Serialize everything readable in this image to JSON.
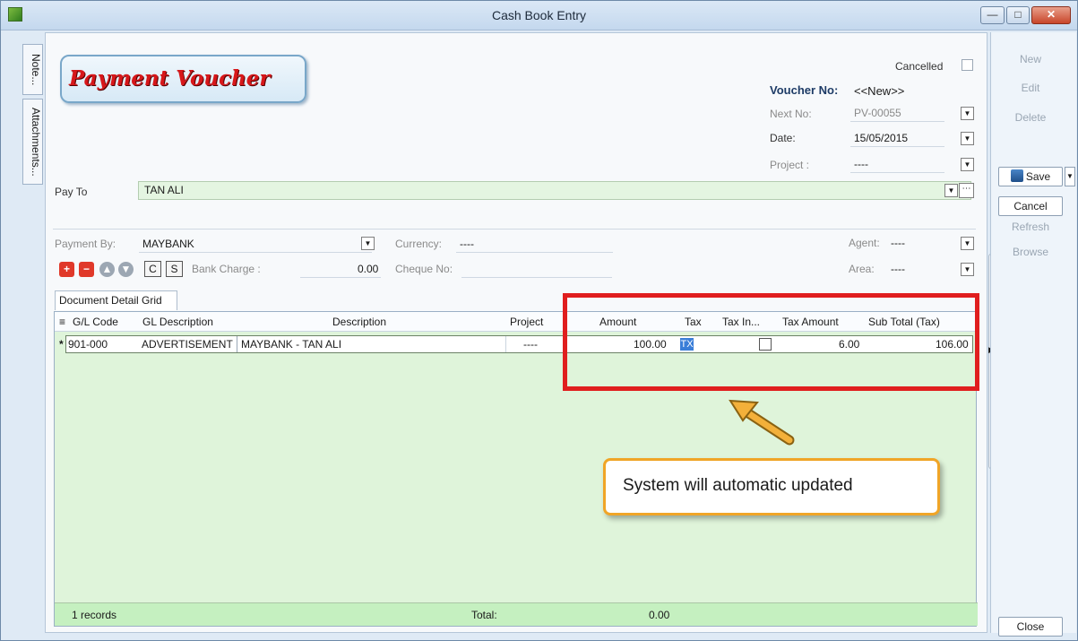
{
  "window": {
    "title": "Cash Book Entry"
  },
  "side_tabs": {
    "note": "Note...",
    "attachments": "Attachments..."
  },
  "header": {
    "logo_text": "Payment Voucher",
    "cancelled_label": "Cancelled",
    "voucher_no_label": "Voucher No:",
    "voucher_no_value": "<<New>>",
    "next_no_label": "Next No:",
    "next_no_value": "PV-00055",
    "date_label": "Date:",
    "date_value": "15/05/2015",
    "project_label": "Project :",
    "project_value": "----"
  },
  "pay_to": {
    "label": "Pay To",
    "value": "TAN ALI"
  },
  "payment": {
    "payment_by_label": "Payment By:",
    "payment_by_value": "MAYBANK",
    "currency_label": "Currency:",
    "currency_value": "----",
    "agent_label": "Agent:",
    "agent_value": "----",
    "area_label": "Area:",
    "area_value": "----",
    "bank_charge_label": "Bank Charge :",
    "bank_charge_value": "0.00",
    "cheque_no_label": "Cheque No:",
    "btn_c": "C",
    "btn_s": "S"
  },
  "grid": {
    "tab_label": "Document Detail Grid",
    "columns": [
      "G/L Code",
      "GL Description",
      "Description",
      "Project",
      "Amount",
      "Tax",
      "Tax In...",
      "Tax Amount",
      "Sub Total (Tax)"
    ],
    "row": {
      "marker": "*",
      "gl_code": "901-000",
      "gl_description": "ADVERTISEMENT",
      "description": "MAYBANK - TAN ALI",
      "project": "----",
      "amount": "100.00",
      "tax": "TX",
      "tax_amount": "6.00",
      "sub_total": "106.00"
    },
    "footer": {
      "records": "1 records",
      "total_label": "Total:",
      "total_value": "0.00"
    }
  },
  "callout": {
    "text": "System will automatic updated"
  },
  "actions": {
    "new": "New",
    "edit": "Edit",
    "delete": "Delete",
    "save": "Save",
    "cancel": "Cancel",
    "refresh": "Refresh",
    "browse": "Browse",
    "close": "Close"
  },
  "colors": {
    "accent_red": "#e01e1e",
    "callout_border": "#f0a527",
    "grid_green": "#dff4da"
  }
}
